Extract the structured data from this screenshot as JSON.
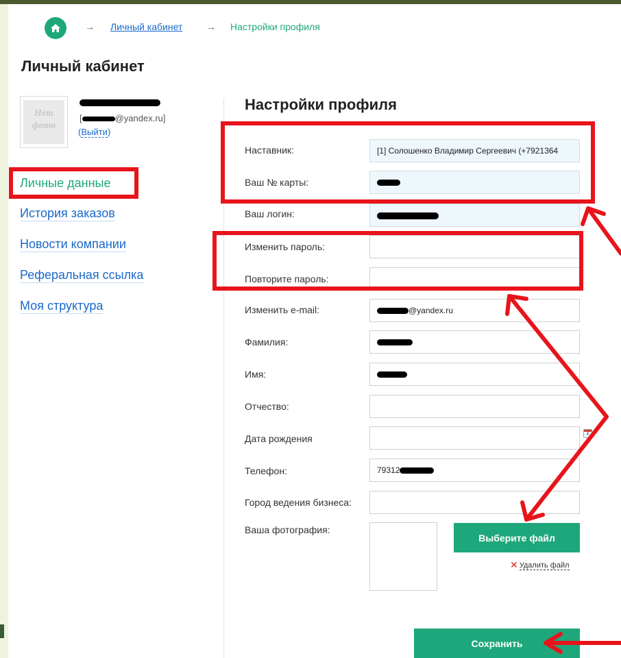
{
  "breadcrumb": {
    "arrow": "→",
    "account_link": "Личный кабинет",
    "current": "Настройки профиля"
  },
  "page_title": "Личный кабинет",
  "user": {
    "avatar_line1": "Нет",
    "avatar_line2": "фото",
    "email_open": "[",
    "email_domain": "@yandex.ru]",
    "logout_open": "(",
    "logout_label": "Выйти",
    "logout_close": ")"
  },
  "sidebar": {
    "items": [
      {
        "label": "Личные данные",
        "active": true
      },
      {
        "label": "История заказов"
      },
      {
        "label": "Новости компании"
      },
      {
        "label": "Реферальная ссылка"
      },
      {
        "label": "Моя структура"
      }
    ]
  },
  "form": {
    "title": "Настройки профиля",
    "mentor_label": "Наставник:",
    "mentor_value": "[1] Солошенко Владимир Сергеевич (+7921364",
    "card_label": "Ваш № карты:",
    "login_label": "Ваш логин:",
    "password_label": "Изменить пароль:",
    "password_repeat_label": "Повторите пароль:",
    "email_label": "Изменить e-mail:",
    "email_value_domain": "@yandex.ru",
    "lastname_label": "Фамилия:",
    "firstname_label": "Имя:",
    "patronymic_label": "Отчество:",
    "birthdate_label": "Дата рождения",
    "calendar_day": "1",
    "phone_label": "Телефон:",
    "phone_value_prefix": "79312",
    "city_label": "Город ведения бизнеса:",
    "photo_label": "Ваша фотография:",
    "choose_file_button": "Выберите файл",
    "delete_file_icon": "✕",
    "delete_file_link": "Удалить файл",
    "save_button": "Сохранить"
  },
  "colors": {
    "accent_green": "#1fa77c",
    "link_blue": "#1a68c9",
    "annotation_red": "#e8141c"
  }
}
